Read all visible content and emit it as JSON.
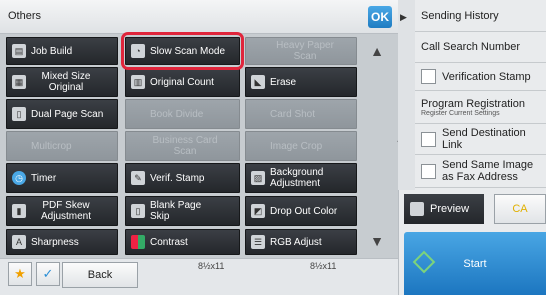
{
  "header": {
    "title": "Others",
    "ok_label": "OK"
  },
  "buttons": {
    "job_build": "Job Build",
    "slow_scan_mode": "Slow Scan Mode",
    "heavy_paper_scan": "Heavy Paper Scan",
    "mixed_size_original": "Mixed Size Original",
    "original_count": "Original Count",
    "erase": "Erase",
    "dual_page_scan": "Dual Page Scan",
    "book_divide": "Book Divide",
    "card_shot": "Card Shot",
    "multicrop": "Multicrop",
    "business_card_scan": "Business Card Scan",
    "image_crop": "Image Crop",
    "timer": "Timer",
    "verif_stamp": "Verif. Stamp",
    "background_adjustment": "Background Adjustment",
    "pdf_skew_adjustment": "PDF Skew Adjustment",
    "blank_page_skip": "Blank Page Skip",
    "drop_out_color": "Drop Out Color",
    "sharpness": "Sharpness",
    "contrast": "Contrast",
    "rgb_adjust": "RGB Adjust"
  },
  "bottom": {
    "back_label": "Back",
    "paper_left": "8½x11",
    "paper_right": "8½x11"
  },
  "right": {
    "sending_history": "Sending History",
    "call_search_number": "Call Search Number",
    "verification_stamp": "Verification Stamp",
    "program_registration": "Program Registration",
    "program_registration_sub": "Register Current Settings",
    "send_destination_link": "Send Destination Link",
    "send_same_image_fax": "Send Same Image as Fax Address",
    "preview_label": "Preview",
    "ca_label": "CA",
    "start_label": "Start"
  },
  "colors": {
    "highlight": "#e0253b",
    "accent": "#1f7cc2",
    "ca": "#e0b000"
  }
}
